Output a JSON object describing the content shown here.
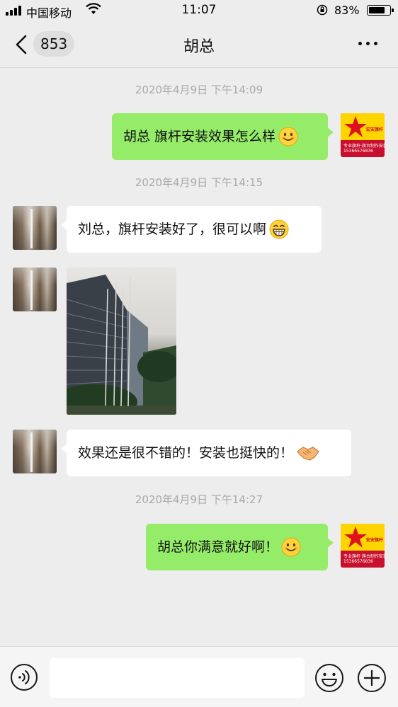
{
  "status_bar": {
    "carrier": "中国移动",
    "time": "11:07",
    "battery": "83%",
    "battery_level": 0.83
  },
  "nav": {
    "back_count": "853",
    "title": "胡总"
  },
  "self_avatar": {
    "brand": "宏安旗杆",
    "line1": "专业旗杆·旗台制作安装",
    "line2": "15366576836"
  },
  "messages": [
    {
      "type": "timestamp",
      "text": "2020年4月9日 下午14:09"
    },
    {
      "type": "sent",
      "text": "胡总 旗杆安装效果怎么样",
      "emoji": "smile-emoji"
    },
    {
      "type": "timestamp",
      "text": "2020年4月9日 下午14:15"
    },
    {
      "type": "recv",
      "text": "刘总，旗杆安装好了，很可以啊",
      "emoji": "grin-emoji"
    },
    {
      "type": "recv-image",
      "image": "flagpole-photo"
    },
    {
      "type": "recv",
      "text": "效果还是很不错的！安装也挺快的！",
      "emoji": "handshake-emoji"
    },
    {
      "type": "timestamp",
      "text": "2020年4月9日 下午14:27"
    },
    {
      "type": "sent",
      "text": "胡总你满意就好啊！",
      "emoji": "smile-emoji"
    }
  ],
  "colors": {
    "sent_bubble": "#95ec69",
    "recv_bubble": "#ffffff",
    "background": "#ededed"
  }
}
